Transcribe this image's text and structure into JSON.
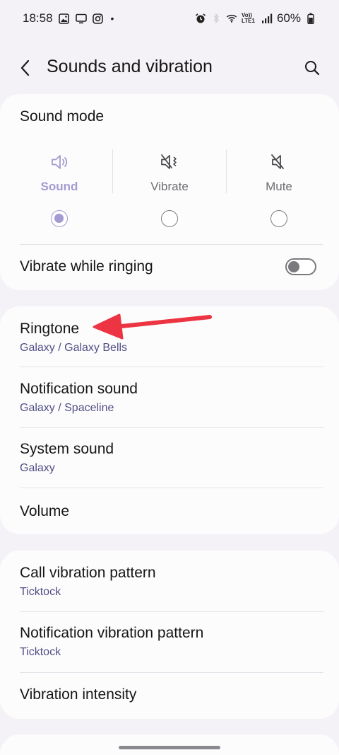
{
  "status_bar": {
    "time": "18:58",
    "dot": "•",
    "battery_percent": "60%",
    "network_label": "Vo)) LTE1"
  },
  "header": {
    "title": "Sounds and vibration"
  },
  "sound_mode": {
    "title": "Sound mode",
    "modes": [
      {
        "label": "Sound",
        "selected": true,
        "icon": "speaker-icon"
      },
      {
        "label": "Vibrate",
        "selected": false,
        "icon": "vibrate-icon"
      },
      {
        "label": "Mute",
        "selected": false,
        "icon": "mute-icon"
      }
    ],
    "vibrate_while_ringing": {
      "label": "Vibrate while ringing",
      "on": false
    }
  },
  "sounds": [
    {
      "title": "Ringtone",
      "subtitle": "Galaxy / Galaxy Bells"
    },
    {
      "title": "Notification sound",
      "subtitle": "Galaxy / Spaceline"
    },
    {
      "title": "System sound",
      "subtitle": "Galaxy"
    },
    {
      "title": "Volume"
    }
  ],
  "vibration": [
    {
      "title": "Call vibration pattern",
      "subtitle": "Ticktock"
    },
    {
      "title": "Notification vibration pattern",
      "subtitle": "Ticktock"
    },
    {
      "title": "Vibration intensity"
    }
  ],
  "colors": {
    "accent": "#a39bd2",
    "subtitle": "#524f86",
    "background": "#f4f2f6",
    "card": "#fcfcfd",
    "annotation_arrow": "#ec3442"
  }
}
